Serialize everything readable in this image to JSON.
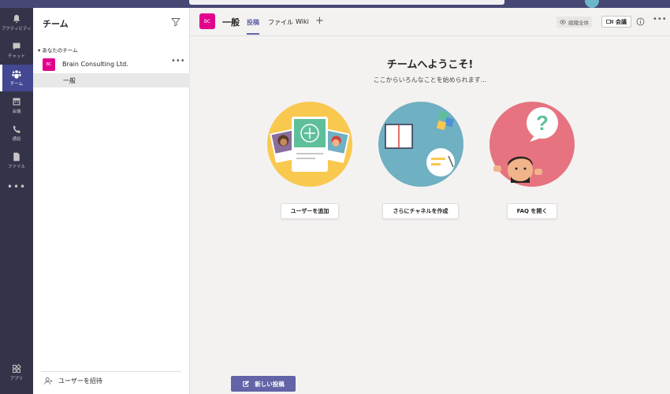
{
  "rail": {
    "items": [
      {
        "label": "アクティビティ",
        "icon": "bell-icon"
      },
      {
        "label": "チャット",
        "icon": "chat-icon"
      },
      {
        "label": "チーム",
        "icon": "teams-icon"
      },
      {
        "label": "会議",
        "icon": "calendar-icon"
      },
      {
        "label": "通話",
        "icon": "phone-icon"
      },
      {
        "label": "ファイル",
        "icon": "file-icon"
      }
    ],
    "more": "•••",
    "apps_label": "アプリ"
  },
  "panel": {
    "title": "チーム",
    "section_label": "あなたのチーム",
    "team_badge": "BC",
    "team_name": "Brain Consulting Ltd.",
    "team_more": "•••",
    "channel_name": "一般",
    "invite_label": "ユーザーを招待"
  },
  "header": {
    "badge": "BC",
    "title": "一般",
    "tabs": [
      "投稿",
      "ファイル",
      "Wiki"
    ],
    "add_tab": "+",
    "org_label": "組織全体",
    "meet_label": "会議",
    "more": "•••"
  },
  "welcome": {
    "title": "チームへようこそ!",
    "subtitle": "ここからいろんなことを始められます...",
    "cards": [
      {
        "button": "ユーザーを追加",
        "illustration": "add-people-illustration"
      },
      {
        "button": "さらにチャネルを作成",
        "illustration": "create-channel-illustration"
      },
      {
        "button": "FAQ を開く",
        "illustration": "faq-illustration"
      }
    ]
  },
  "new_post_label": "新しい投稿",
  "colors": {
    "rail_bg": "#33344a",
    "accent": "#6264a7",
    "team_badge": "#e3008c",
    "card1_bg": "#f9c84f",
    "card2_bg": "#6fb0c2",
    "card3_bg": "#e6737f"
  }
}
